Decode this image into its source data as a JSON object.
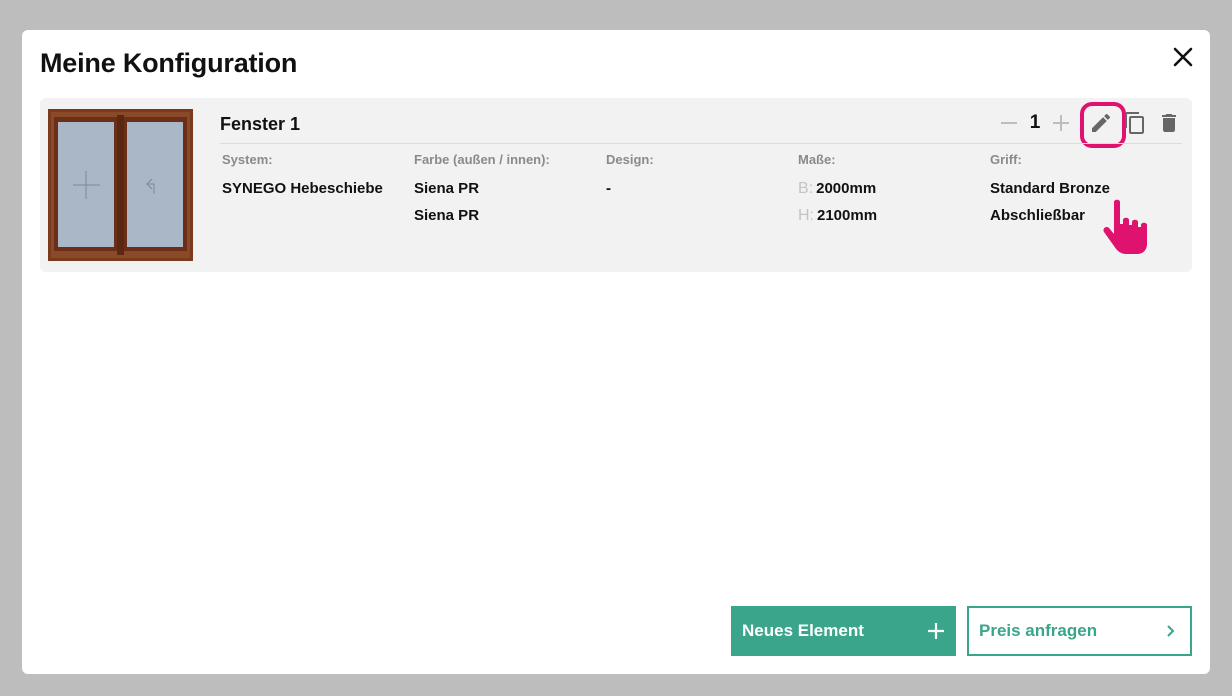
{
  "modal": {
    "title": "Meine Konfiguration"
  },
  "item": {
    "name": "Fenster 1",
    "quantity": "1",
    "system": {
      "label": "System:",
      "value": "SYNEGO Hebeschiebe"
    },
    "color": {
      "label": "Farbe (außen / innen):",
      "outside": "Siena PR",
      "inside": "Siena PR"
    },
    "design": {
      "label": "Design:",
      "value": "-"
    },
    "dimensions": {
      "label": "Maße:",
      "width_prefix": "B:",
      "width": "2000mm",
      "height_prefix": "H:",
      "height": "2100mm"
    },
    "handle": {
      "label": "Griff:",
      "value1": "Standard Bronze",
      "value2": "Abschließbar"
    }
  },
  "footer": {
    "new_element_label": "Neues Element",
    "request_price_label": "Preis anfragen"
  },
  "colors": {
    "accent": "#3aa58a",
    "highlight": "#e0126f",
    "frame": "#7a3a1c",
    "glass": "#aab7c6"
  },
  "icons": [
    "close-icon",
    "minus-icon",
    "plus-icon",
    "pencil-icon",
    "copy-icon",
    "trash-icon",
    "hand-pointer-icon",
    "chevron-right-icon"
  ]
}
